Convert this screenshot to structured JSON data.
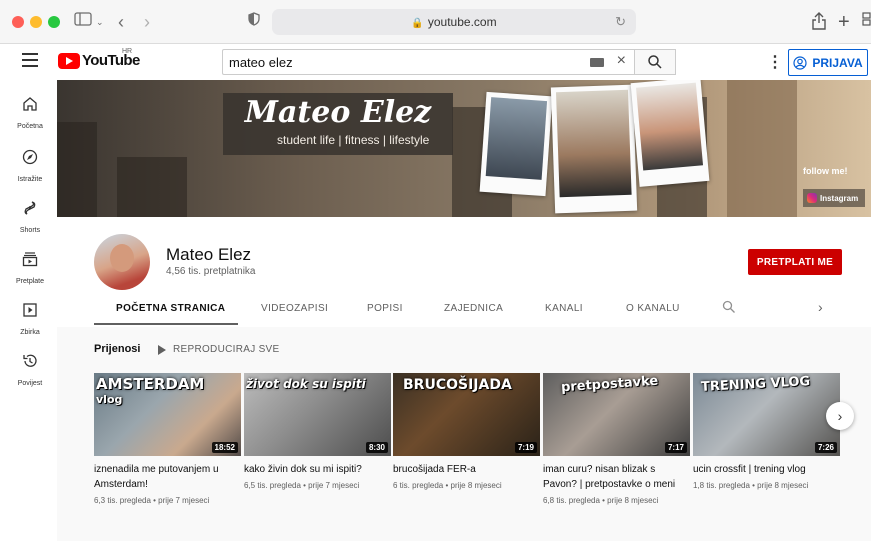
{
  "browser": {
    "url": "youtube.com"
  },
  "header": {
    "logo_text": "YouTube",
    "country_code": "HR",
    "search_value": "mateo elez",
    "signin_label": "PRIJAVA"
  },
  "sidebar": {
    "items": [
      {
        "label": "Početna",
        "icon": "home-icon"
      },
      {
        "label": "Istražite",
        "icon": "compass-icon"
      },
      {
        "label": "Shorts",
        "icon": "shorts-icon"
      },
      {
        "label": "Pretplate",
        "icon": "subscriptions-icon"
      },
      {
        "label": "Zbirka",
        "icon": "library-icon"
      },
      {
        "label": "Povijest",
        "icon": "history-icon"
      }
    ]
  },
  "banner": {
    "title": "Mateo Elez",
    "subtitle": "student life  |  fitness  |  lifestyle",
    "follow_text": "follow me!",
    "instagram_label": "Instagram"
  },
  "channel": {
    "name": "Mateo Elez",
    "subscribers": "4,56 tis. pretplatnika",
    "subscribe_label": "PRETPLATI ME"
  },
  "tabs": [
    {
      "label": "POČETNA STRANICA",
      "active": true
    },
    {
      "label": "VIDEOZAPISI",
      "active": false
    },
    {
      "label": "POPISI",
      "active": false
    },
    {
      "label": "ZAJEDNICA",
      "active": false
    },
    {
      "label": "KANALI",
      "active": false
    },
    {
      "label": "O KANALU",
      "active": false
    }
  ],
  "shelf": {
    "title": "Prijenosi",
    "play_all_label": "REPRODUCIRAJ SVE",
    "videos": [
      {
        "thumb_text": "AMSTERDAM",
        "thumb_text2": "vlog",
        "duration": "18:52",
        "title": "iznenadila me putovanjem u Amsterdam!",
        "meta": "6,3 tis. pregleda • prije 7 mjeseci"
      },
      {
        "thumb_text": "život dok su ispiti",
        "duration": "8:30",
        "title": "kako živin dok su mi ispiti?",
        "meta": "6,5 tis. pregleda • prije 7 mjeseci"
      },
      {
        "thumb_text": "BRUCOŠIJADA",
        "duration": "7:19",
        "title": "brucošijada FER-a",
        "meta": "6 tis. pregleda • prije 8 mjeseci"
      },
      {
        "thumb_text": "pretpostavke",
        "duration": "7:17",
        "title": "iman curu? nisan blizak s Pavon? | pretpostavke o meni",
        "meta": "6,8 tis. pregleda • prije 8 mjeseci"
      },
      {
        "thumb_text": "TRENING VLOG",
        "duration": "7:26",
        "title": "ucin crossfit | trening vlog",
        "meta": "1,8 tis. pregleda • prije 8 mjeseci"
      }
    ]
  }
}
